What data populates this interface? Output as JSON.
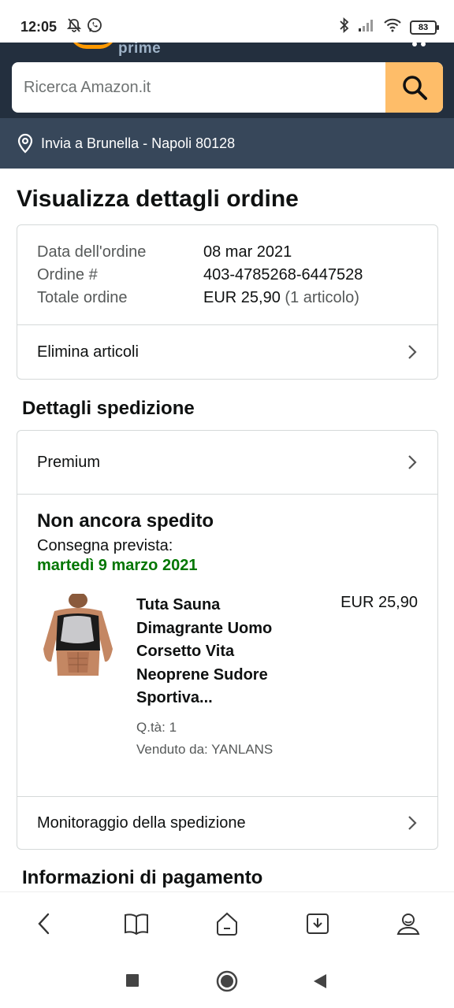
{
  "status_bar": {
    "time": "12:05",
    "battery": "83"
  },
  "header": {
    "logo_text": "prime",
    "search_placeholder": "Ricerca Amazon.it",
    "deliver_to": "Invia a Brunella - Napoli 80128"
  },
  "page": {
    "title": "Visualizza dettagli ordine"
  },
  "order_summary": {
    "date_label": "Data dell'ordine",
    "date_value": "08 mar 2021",
    "number_label": "Ordine #",
    "number_value": "403-4785268-6447528",
    "total_label": "Totale ordine",
    "total_value": "EUR 25,90",
    "total_items": "(1 articolo)",
    "remove_items_label": "Elimina articoli"
  },
  "shipping": {
    "section_title": "Dettagli spedizione",
    "method": "Premium",
    "status": "Non ancora spedito",
    "expected_label": "Consegna prevista:",
    "expected_date": "martedì 9 marzo 2021",
    "product": {
      "title": "Tuta Sauna Dimagrante Uomo Corsetto Vita Neoprene Sudore Sportiva...",
      "quantity": "Q.tà: 1",
      "seller": "Venduto da: YANLANS",
      "price": "EUR 25,90"
    },
    "tracking_label": "Monitoraggio della spedizione"
  },
  "payment": {
    "section_title": "Informazioni di pagamento"
  },
  "colors": {
    "header_bg": "#232f3e",
    "deliver_bg": "#37475a",
    "search_button": "#febd69",
    "delivery_green": "#007600"
  }
}
